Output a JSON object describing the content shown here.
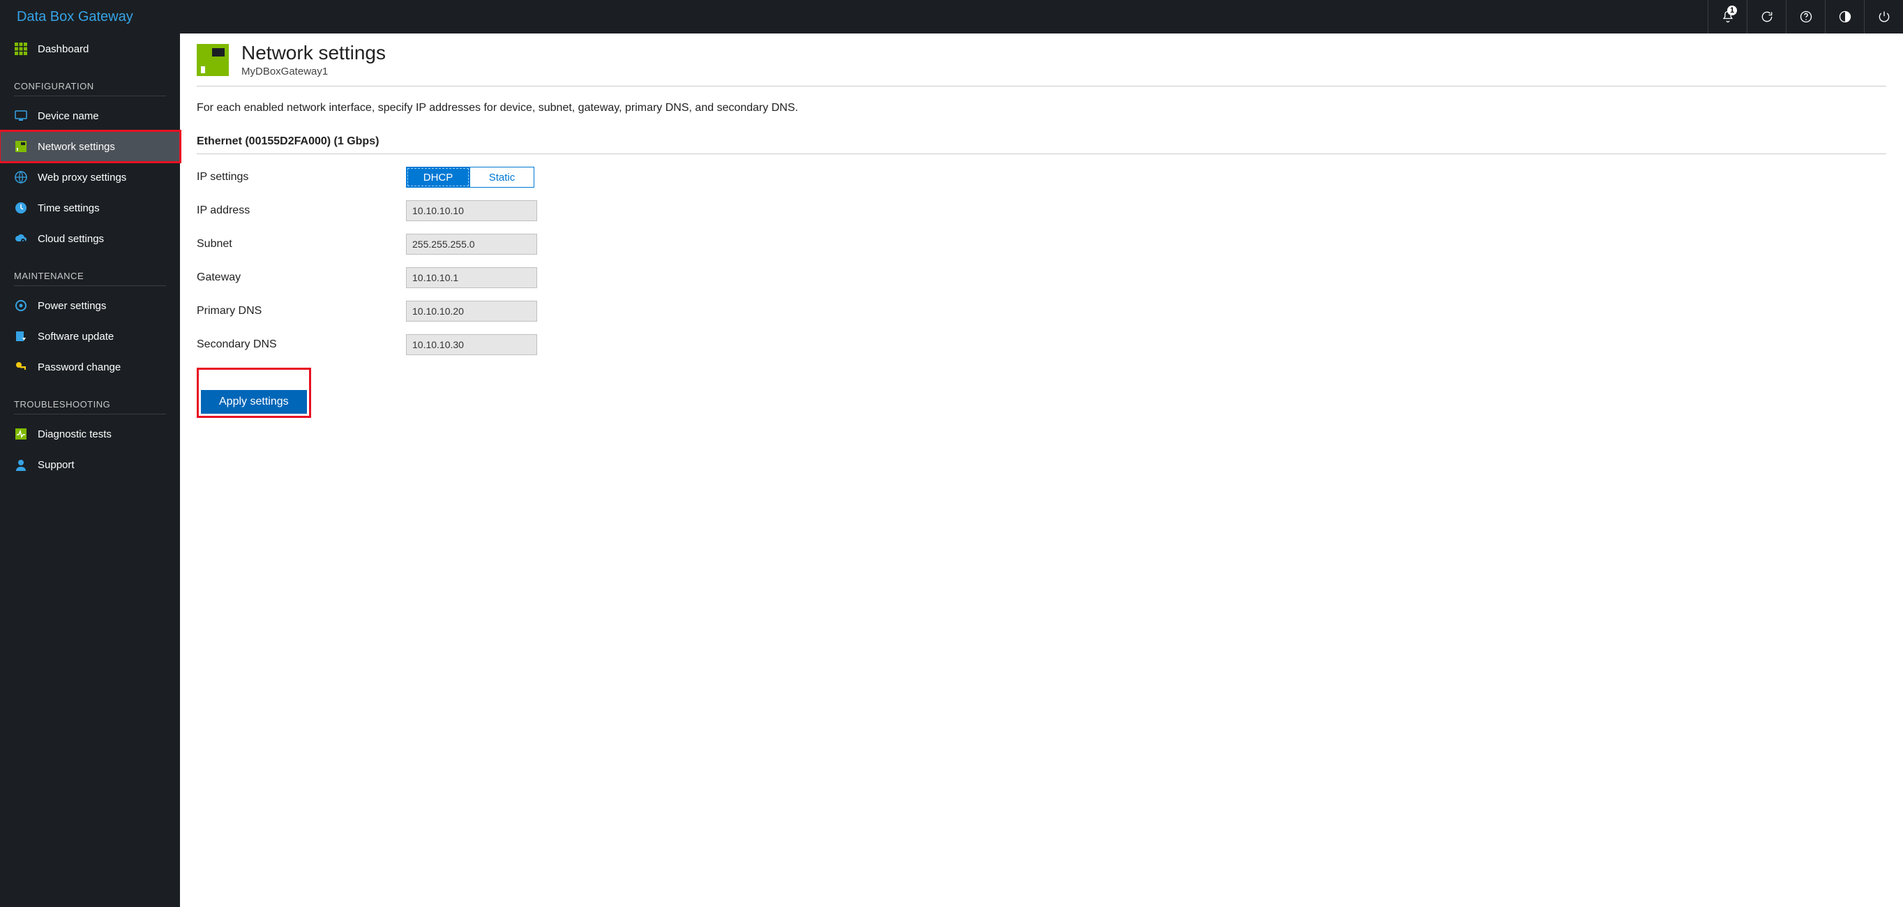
{
  "topbar": {
    "brand": "Data Box Gateway",
    "notification_count": "1"
  },
  "sidebar": {
    "dashboard": "Dashboard",
    "sections": {
      "configuration": "CONFIGURATION",
      "maintenance": "MAINTENANCE",
      "troubleshooting": "TROUBLESHOOTING"
    },
    "items": {
      "device_name": "Device name",
      "network_settings": "Network settings",
      "web_proxy_settings": "Web proxy settings",
      "time_settings": "Time settings",
      "cloud_settings": "Cloud settings",
      "power_settings": "Power settings",
      "software_update": "Software update",
      "password_change": "Password change",
      "diagnostic_tests": "Diagnostic tests",
      "support": "Support"
    }
  },
  "page": {
    "title": "Network settings",
    "subtitle": "MyDBoxGateway1",
    "intro": "For each enabled network interface, specify IP addresses for device, subnet, gateway, primary DNS, and secondary DNS.",
    "interface_title": "Ethernet (00155D2FA000) (1 Gbps)",
    "labels": {
      "ip_settings": "IP settings",
      "ip_address": "IP address",
      "subnet": "Subnet",
      "gateway": "Gateway",
      "primary_dns": "Primary DNS",
      "secondary_dns": "Secondary DNS"
    },
    "toggle": {
      "dhcp": "DHCP",
      "static": "Static"
    },
    "values": {
      "ip_address": "10.10.10.10",
      "subnet": "255.255.255.0",
      "gateway": "10.10.10.1",
      "primary_dns": "10.10.10.20",
      "secondary_dns": "10.10.10.30"
    },
    "apply": "Apply settings"
  }
}
